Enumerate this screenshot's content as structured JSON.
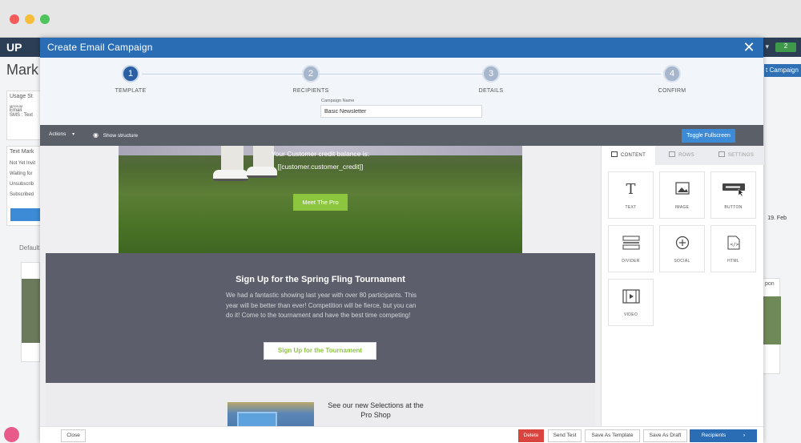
{
  "window": {
    "traffic_lights": [
      "red",
      "yellow",
      "green"
    ]
  },
  "background_app": {
    "logo": "UP",
    "heading": "Mark",
    "panel1_title": "Usage St",
    "panel1_lines": [
      "MEDIUM",
      "Email",
      "SMS : Text"
    ],
    "panel2_title": "Text Mark",
    "panel2_lines": [
      "Not Yet Invit",
      "Waiting for",
      "Unsubscrib",
      "Subscribed"
    ],
    "right_button": "t Campaign",
    "topright_text": "in ▾",
    "chart_label": "19. Feb",
    "tab_label": "Default",
    "right_card_label": "pon"
  },
  "modal": {
    "title": "Create Email Campaign",
    "close_label": "✕",
    "steps": [
      {
        "number": "1",
        "label": "TEMPLATE",
        "active": true
      },
      {
        "number": "2",
        "label": "RECIPIENTS",
        "active": false
      },
      {
        "number": "3",
        "label": "DETAILS",
        "active": false
      },
      {
        "number": "4",
        "label": "CONFIRM",
        "active": false
      }
    ],
    "campaign_name_label": "Campaign Name",
    "campaign_name_value": "Basic Newsletter",
    "toolbar": {
      "actions_label": "Actions",
      "show_structure_label": "Show structure",
      "fullscreen_label": "Toggle Fullscreen"
    },
    "email": {
      "hero_line1": "Your Customer credit balance is:",
      "hero_line2": "[[customer.customer_credit]]",
      "hero_button": "Meet The Pro",
      "promo_title": "Sign Up for the Spring Fling Tournament",
      "promo_body": "We had a fantastic showing last year with over 80 participants. This year will be better than ever! Competition will be fierce, but you can do it! Come to the tournament and have the best time competing!",
      "promo_button": "Sign Up for the Tournament",
      "shop_title": "See our new Selections at the Pro Shop"
    },
    "side_panel": {
      "tabs": [
        "CONTENT",
        "ROWS",
        "SETTINGS"
      ],
      "tiles": [
        {
          "label": "TEXT",
          "icon": "text-icon"
        },
        {
          "label": "IMAGE",
          "icon": "image-icon"
        },
        {
          "label": "BUTTON",
          "icon": "button-icon"
        },
        {
          "label": "DIVIDER",
          "icon": "divider-icon"
        },
        {
          "label": "SOCIAL",
          "icon": "social-icon"
        },
        {
          "label": "HTML",
          "icon": "html-icon"
        },
        {
          "label": "VIDEO",
          "icon": "video-icon"
        }
      ]
    },
    "footer": {
      "close": "Close",
      "delete": "Delete",
      "send_test": "Send Test",
      "save_template": "Save As Template",
      "save_draft": "Save As Draft",
      "recipients": "Recipients"
    }
  },
  "colors": {
    "modal_header": "#2a6db5",
    "active_step": "#2a5fa3",
    "cta_green": "#8cc63f",
    "delete_red": "#d9443f"
  }
}
